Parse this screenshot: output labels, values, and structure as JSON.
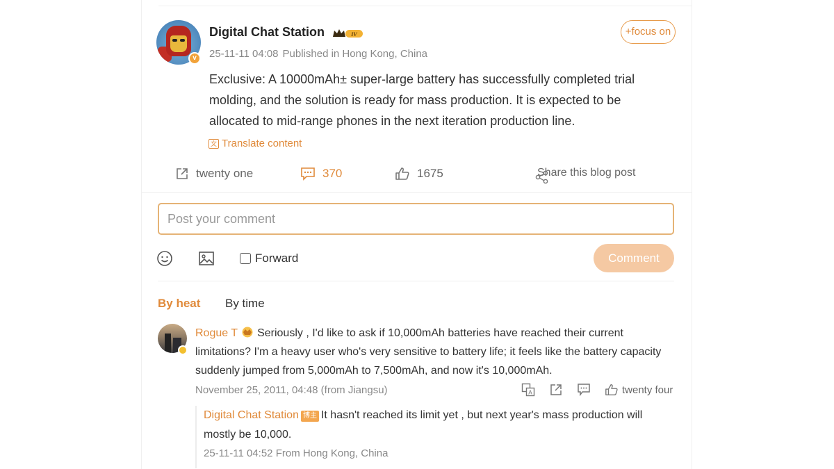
{
  "post": {
    "author": "Digital Chat Station",
    "level_badge": "IV",
    "published_time": "25-11-11 04:08",
    "published_location": "Published in Hong Kong, China",
    "focus_label": "+focus on",
    "body": "Exclusive: A 10000mAh± super-large battery has successfully completed trial molding, and the solution is ready for mass production. It is expected to be allocated to mid-range phones in the next iteration production line.",
    "translate_label": "Translate content",
    "actions": {
      "repost_count": "twenty one",
      "comment_count": "370",
      "like_count": "1675",
      "share_label": "Share this blog post"
    }
  },
  "composer": {
    "placeholder": "Post your comment",
    "forward_label": "Forward",
    "comment_button": "Comment"
  },
  "sort_tabs": {
    "heat": "By heat",
    "time": "By time"
  },
  "comments": [
    {
      "user": "Rogue T",
      "text": "Seriously , I'd like to ask if 10,000mAh batteries have reached their current limitations? I'm a heavy user who's very sensitive to battery life; it feels like the battery capacity suddenly jumped from 5,000mAh to 7,500mAh, and now it's 10,000mAh.",
      "meta": "November 25, 2011, 04:48 (from Jiangsu)",
      "likes": "twenty four",
      "reply": {
        "user": "Digital Chat Station",
        "badge": "博主",
        "text": "It hasn't reached its limit yet , but next year's mass production will mostly be 10,000.",
        "meta": "25-11-11 04:52 From Hong Kong, China"
      }
    }
  ],
  "colors": {
    "accent": "#e08a3a",
    "comment_button_bg": "#f5c9a3",
    "input_border": "#e5b376"
  },
  "icons": {
    "repost": "external-link-icon",
    "comment": "chat-bubble-icon",
    "like": "thumbs-up-icon",
    "share": "share-icon",
    "emoji": "smiley-icon",
    "image": "image-icon",
    "translate": "translate-icon"
  }
}
